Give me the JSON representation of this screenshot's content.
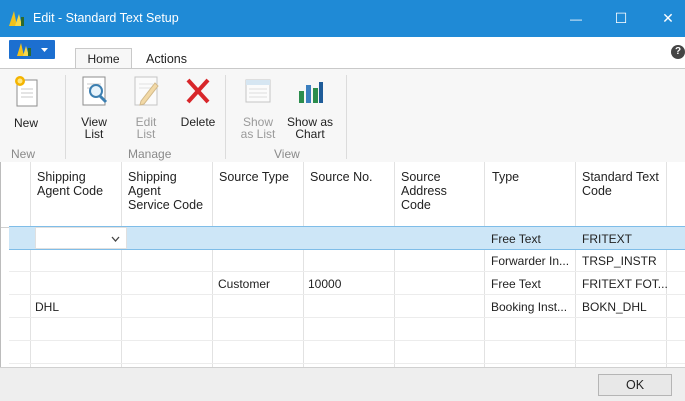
{
  "window": {
    "title": "Edit - Standard Text Setup",
    "minimize_glyph": "—",
    "maximize_glyph": "☐",
    "close_glyph": "✕",
    "accent_color": "#1f8ad6"
  },
  "ribbon_tabs": {
    "home": "Home",
    "actions": "Actions",
    "help_glyph": "?"
  },
  "ribbon": {
    "new_group": {
      "label": "New",
      "new_button": "New"
    },
    "manage_group": {
      "label": "Manage",
      "view_list_line1": "View",
      "view_list_line2": "List",
      "edit_list_line1": "Edit",
      "edit_list_line2": "List",
      "delete": "Delete"
    },
    "view_group": {
      "label": "View",
      "show_list_line1": "Show",
      "show_list_line2": "as List",
      "show_chart_line1": "Show as",
      "show_chart_line2": "Chart"
    }
  },
  "grid": {
    "columns": [
      [
        "Shipping",
        "Agent Code",
        ""
      ],
      [
        "Shipping",
        "Agent",
        "Service Code"
      ],
      [
        "Source Type",
        "",
        ""
      ],
      [
        "Source No.",
        "",
        ""
      ],
      [
        "Source",
        "Address",
        "Code"
      ],
      [
        "Type",
        "",
        ""
      ],
      [
        "Standard Text",
        "Code",
        ""
      ]
    ],
    "rows": [
      [
        "",
        "",
        "",
        "",
        "",
        "Free Text",
        "FRITEXT"
      ],
      [
        "",
        "",
        "",
        "",
        "",
        "Forwarder In...",
        "TRSP_INSTR"
      ],
      [
        "",
        "",
        "Customer",
        "10000",
        "",
        "Free Text",
        "FRITEXT FOT..."
      ],
      [
        "DHL",
        "",
        "",
        "",
        "",
        "Booking Inst...",
        "BOKN_DHL"
      ],
      [
        "",
        "",
        "",
        "",
        "",
        "",
        ""
      ],
      [
        "",
        "",
        "",
        "",
        "",
        "",
        ""
      ]
    ],
    "selection_color": "#cde6f7"
  },
  "footer": {
    "ok": "OK"
  }
}
